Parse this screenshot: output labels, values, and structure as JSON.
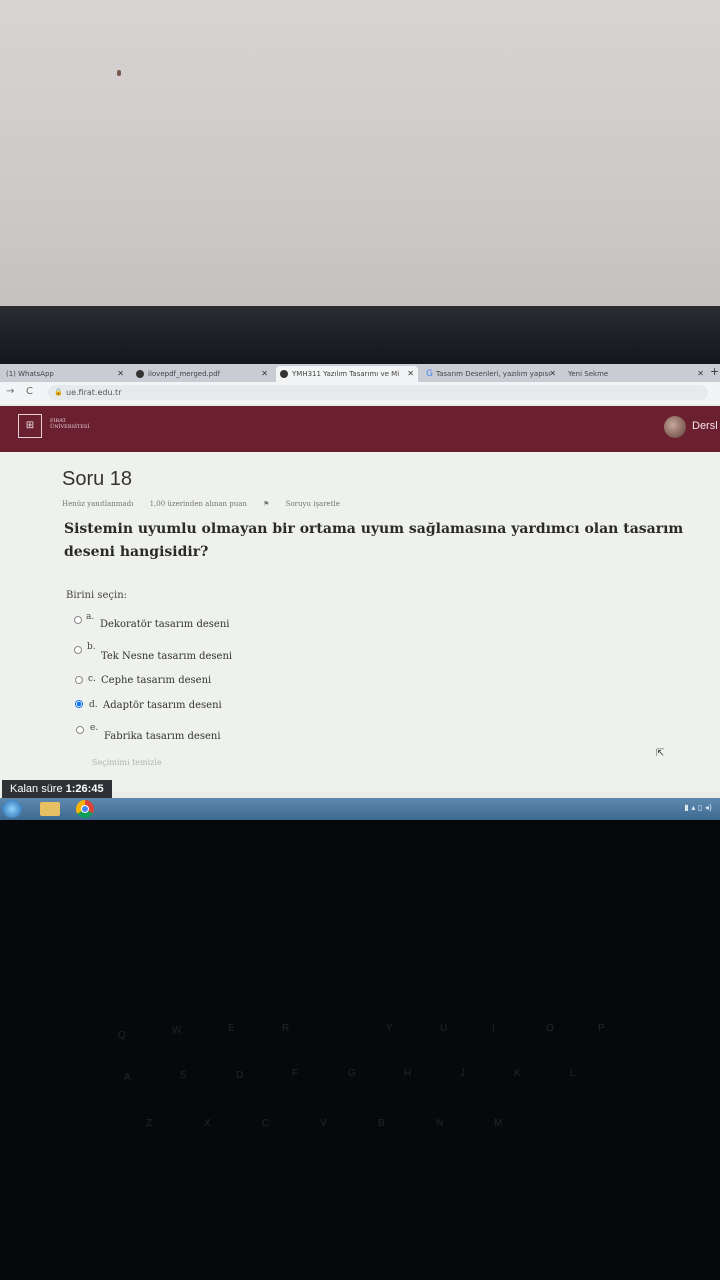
{
  "browser": {
    "tabs": [
      {
        "label": "(1) WhatsApp"
      },
      {
        "label": "ilovepdf_merged.pdf"
      },
      {
        "label": "YMH311 Yazılım Tasarımı ve Mi"
      },
      {
        "label": "Tasarım Desenleri, yazılım yapısı"
      },
      {
        "label": "Yeni Sekme"
      }
    ],
    "url": "ue.firat.edu.tr",
    "new_tab": "+"
  },
  "header": {
    "logo_text_line1": "FIRAT",
    "logo_text_line2": "ÜNİVERSİTESİ",
    "user_label": "Dersl"
  },
  "question": {
    "title": "Soru 18",
    "status": "Henüz yanıtlanmadı",
    "points": "1,00 üzerinden alınan puan",
    "flag": "Soruyu işaretle",
    "text": "Sistemin uyumlu olmayan bir ortama uyum sağlamasına yardımcı olan tasarım deseni hangisidir?",
    "prompt": "Birini seçin:",
    "options": [
      {
        "letter": "a.",
        "text": "Dekoratör tasarım deseni",
        "selected": false
      },
      {
        "letter": "b.",
        "text": "Tek Nesne tasarım deseni",
        "selected": false
      },
      {
        "letter": "c.",
        "text": "Cephe tasarım deseni",
        "selected": false
      },
      {
        "letter": "d.",
        "text": "Adaptör tasarım deseni",
        "selected": true
      },
      {
        "letter": "e.",
        "text": "Fabrika tasarım deseni",
        "selected": false
      }
    ],
    "clear_choice": "Seçimimi temizle"
  },
  "timer": {
    "label": "Kalan süre",
    "value": "1:26:45"
  },
  "colors": {
    "header": "#6b2030",
    "radio_selected": "#1a73e8",
    "taskbar": "#4a78a0"
  }
}
